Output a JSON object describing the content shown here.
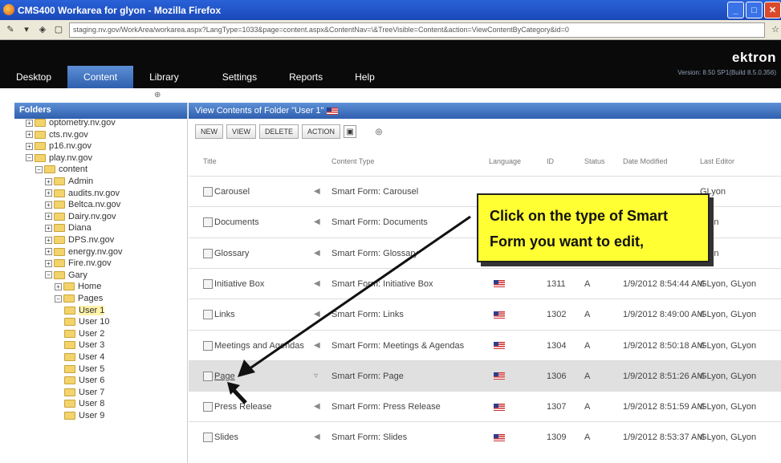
{
  "window": {
    "title": "CMS400 Workarea for glyon - Mozilla Firefox",
    "url": "staging.nv.gov/WorkArea/workarea.aspx?LangType=1033&page=content.aspx&ContentNav=\\&TreeVisible=Content&action=ViewContentByCategory&id=0"
  },
  "nav": {
    "tabs": [
      "Desktop",
      "Content",
      "Library",
      "Settings",
      "Reports",
      "Help"
    ],
    "active_tab": "Content",
    "brand": "ektron",
    "version": "Version: 8.50 SP1(Build 8.5.0.356)"
  },
  "tree": {
    "header": "Folders",
    "nodes": [
      {
        "label": "optometry.nv.gov",
        "level": 2,
        "pm": "+"
      },
      {
        "label": "cts.nv.gov",
        "level": 2,
        "pm": "+"
      },
      {
        "label": "p16.nv.gov",
        "level": 2,
        "pm": "+"
      },
      {
        "label": "play.nv.gov",
        "level": 2,
        "pm": "−"
      },
      {
        "label": "content",
        "level": 3,
        "pm": "−"
      },
      {
        "label": "Admin",
        "level": 4,
        "pm": "+"
      },
      {
        "label": "audits.nv.gov",
        "level": 4,
        "pm": "+"
      },
      {
        "label": "Beltca.nv.gov",
        "level": 4,
        "pm": "+"
      },
      {
        "label": "Dairy.nv.gov",
        "level": 4,
        "pm": "+"
      },
      {
        "label": "Diana",
        "level": 4,
        "pm": "+"
      },
      {
        "label": "DPS.nv.gov",
        "level": 4,
        "pm": "+"
      },
      {
        "label": "energy.nv.gov",
        "level": 4,
        "pm": "+"
      },
      {
        "label": "Fire.nv.gov",
        "level": 4,
        "pm": "+"
      },
      {
        "label": "Gary",
        "level": 4,
        "pm": "−"
      },
      {
        "label": "Home",
        "level": 5,
        "pm": "+"
      },
      {
        "label": "Pages",
        "level": 5,
        "pm": "−"
      },
      {
        "label": "User 1",
        "level": 6,
        "pm": "",
        "selected": true
      },
      {
        "label": "User 10",
        "level": 6,
        "pm": ""
      },
      {
        "label": "User 2",
        "level": 6,
        "pm": ""
      },
      {
        "label": "User 3",
        "level": 6,
        "pm": ""
      },
      {
        "label": "User 4",
        "level": 6,
        "pm": ""
      },
      {
        "label": "User 5",
        "level": 6,
        "pm": ""
      },
      {
        "label": "User 6",
        "level": 6,
        "pm": ""
      },
      {
        "label": "User 7",
        "level": 6,
        "pm": ""
      },
      {
        "label": "User 8",
        "level": 6,
        "pm": ""
      },
      {
        "label": "User 9",
        "level": 6,
        "pm": ""
      }
    ]
  },
  "content": {
    "header": "View Contents of Folder \"User 1\"",
    "toolbar": [
      "NEW",
      "VIEW",
      "DELETE",
      "ACTION"
    ],
    "columns": [
      "Title",
      "Content Type",
      "Language",
      "ID",
      "Status",
      "Date Modified",
      "Last Editor"
    ],
    "rows": [
      {
        "title": "Carousel",
        "type": "Smart Form: Carousel",
        "id": "",
        "status": "",
        "date": "",
        "editor": "GLyon",
        "flag": false
      },
      {
        "title": "Documents",
        "type": "Smart Form: Documents",
        "id": "",
        "status": "",
        "date": "",
        "editor": "Lyon",
        "flag": false
      },
      {
        "title": "Glossary",
        "type": "Smart Form: Glossary",
        "id": "",
        "status": "",
        "date": "",
        "editor": "Lyon",
        "flag": false
      },
      {
        "title": "Initiative Box",
        "type": "Smart Form: Initiative Box",
        "id": "1311",
        "status": "A",
        "date": "1/9/2012 8:54:44 AM",
        "editor": "GLyon, GLyon",
        "flag": true
      },
      {
        "title": "Links",
        "type": "Smart Form: Links",
        "id": "1302",
        "status": "A",
        "date": "1/9/2012 8:49:00 AM",
        "editor": "GLyon, GLyon",
        "flag": true
      },
      {
        "title": "Meetings and Agendas",
        "type": "Smart Form: Meetings & Agendas",
        "id": "1304",
        "status": "A",
        "date": "1/9/2012 8:50:18 AM",
        "editor": "GLyon, GLyon",
        "flag": true
      },
      {
        "title": "Page",
        "type": "Smart Form: Page",
        "id": "1306",
        "status": "A",
        "date": "1/9/2012 8:51:26 AM",
        "editor": "GLyon, GLyon",
        "flag": true,
        "selected": true
      },
      {
        "title": "Press Release",
        "type": "Smart Form: Press Release",
        "id": "1307",
        "status": "A",
        "date": "1/9/2012 8:51:59 AM",
        "editor": "GLyon, GLyon",
        "flag": true
      },
      {
        "title": "Slides",
        "type": "Smart Form: Slides",
        "id": "1309",
        "status": "A",
        "date": "1/9/2012 8:53:37 AM",
        "editor": "GLyon, GLyon",
        "flag": true
      }
    ]
  },
  "callout": {
    "line1": "Click on the type of Smart",
    "line2": "Form you want to edit,"
  }
}
